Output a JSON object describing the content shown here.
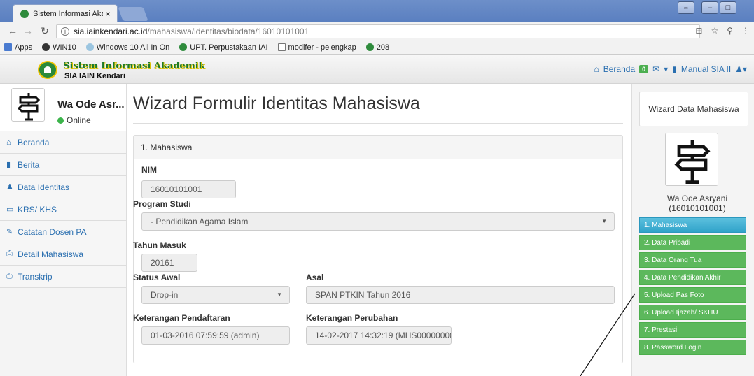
{
  "browser": {
    "tab_title": "Sistem Informasi Akaden",
    "tab_close": "×",
    "url_host": "sia.iainkendari.ac.id",
    "url_path": "/mahasiswa/identitas/biodata/16010101001",
    "bookmarks": [
      "Apps",
      "WIN10",
      "Windows 10 All In On",
      "UPT. Perpustakaan IAI",
      "modifer - pelengkap",
      "208"
    ]
  },
  "header": {
    "brand": "Sistem Informasi Akademik",
    "brand_sub": "SIA IAIN Kendari",
    "nav_home": "Beranda",
    "badge_count": "0",
    "nav_manual": "Manual SIA II"
  },
  "sidebar": {
    "name": "Wa Ode Asr...",
    "status": "Online",
    "items": [
      {
        "icon": "home-icon",
        "label": "Beranda"
      },
      {
        "icon": "book-icon",
        "label": "Berita"
      },
      {
        "icon": "user-icon",
        "label": "Data Identitas"
      },
      {
        "icon": "folder-icon",
        "label": "KRS/ KHS"
      },
      {
        "icon": "edit-icon",
        "label": "Catatan Dosen PA"
      },
      {
        "icon": "print-icon",
        "label": "Detail Mahasiswa"
      },
      {
        "icon": "print-icon",
        "label": "Transkrip"
      }
    ]
  },
  "main": {
    "title": "Wizard Formulir Identitas Mahasiswa",
    "panel_title": "1. Mahasiswa",
    "fields": {
      "nim_label": "NIM",
      "nim_value": "16010101001",
      "prodi_label": "Program Studi",
      "prodi_value": "- Pendidikan Agama Islam",
      "tahun_label": "Tahun Masuk",
      "tahun_value": "20161",
      "status_label": "Status Awal",
      "status_value": "Drop-in",
      "asal_label": "Asal",
      "asal_value": "SPAN PTKIN Tahun 2016",
      "ket_daftar_label": "Keterangan Pendaftaran",
      "ket_daftar_value": "01-03-2016 07:59:59 (admin)",
      "ket_ubah_label": "Keterangan Perubahan",
      "ket_ubah_value": "14-02-2017 14:32:19 (MHS00000000"
    }
  },
  "wizard": {
    "title": "Wizard Data Mahasiswa",
    "name": "Wa Ode Asryani",
    "nim": "(16010101001)",
    "steps": [
      "1. Mahasiswa",
      "2. Data Pribadi",
      "3. Data Orang Tua",
      "4. Data Pendidikan Akhir",
      "5. Upload Pas Foto",
      "6. Upload Ijazah/ SKHU",
      "7. Prestasi",
      "8. Password Login"
    ],
    "active_step": 0
  },
  "colors": {
    "accent_blue": "#2a6fb0",
    "step_green": "#5cb85c",
    "step_active": "#31a3c9",
    "brand_green": "#1d7a2a"
  }
}
